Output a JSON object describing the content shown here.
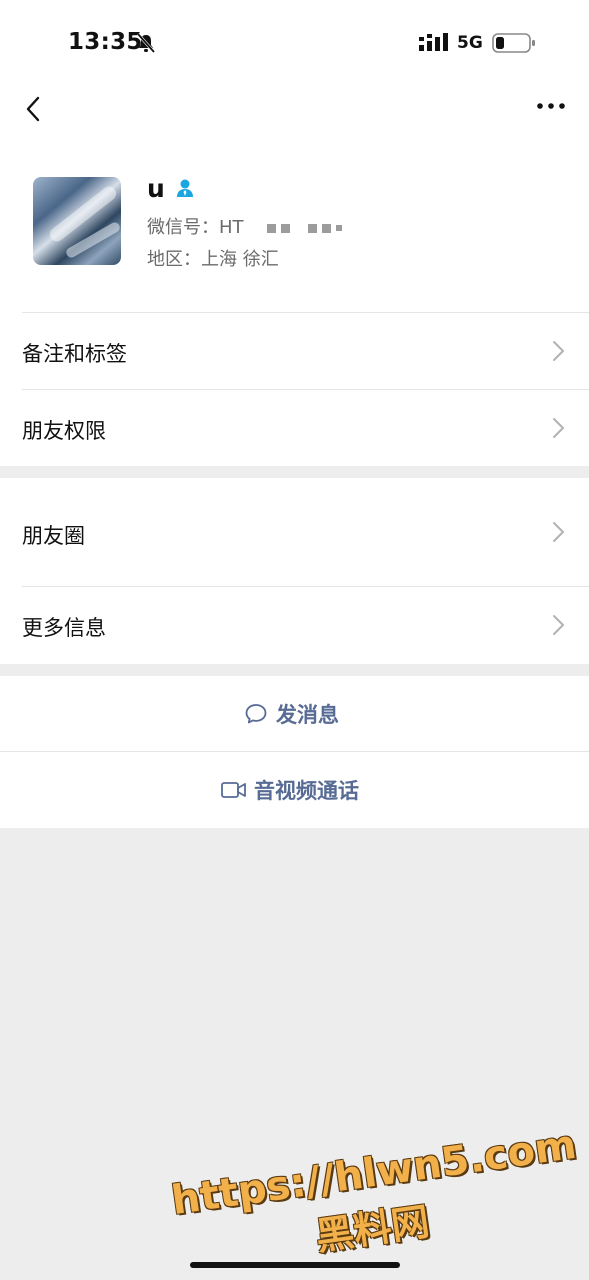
{
  "status_bar": {
    "time": "13:35",
    "network": "5G"
  },
  "profile": {
    "name": "u",
    "wechat_id": "微信号：HT",
    "region": "地区：上海 徐汇"
  },
  "menu_group_1": [
    {
      "label": "备注和标签"
    },
    {
      "label": "朋友权限"
    }
  ],
  "menu_group_2": [
    {
      "label": "朋友圈"
    },
    {
      "label": "更多信息"
    }
  ],
  "actions": {
    "send_message": "发消息",
    "av_call": "音视频通话"
  },
  "watermark": {
    "line1": "https://hlwn5.com",
    "line2": "黑料网"
  },
  "colors": {
    "link": "#576b95",
    "background": "#ededed",
    "badge": "#1aa6e0"
  }
}
